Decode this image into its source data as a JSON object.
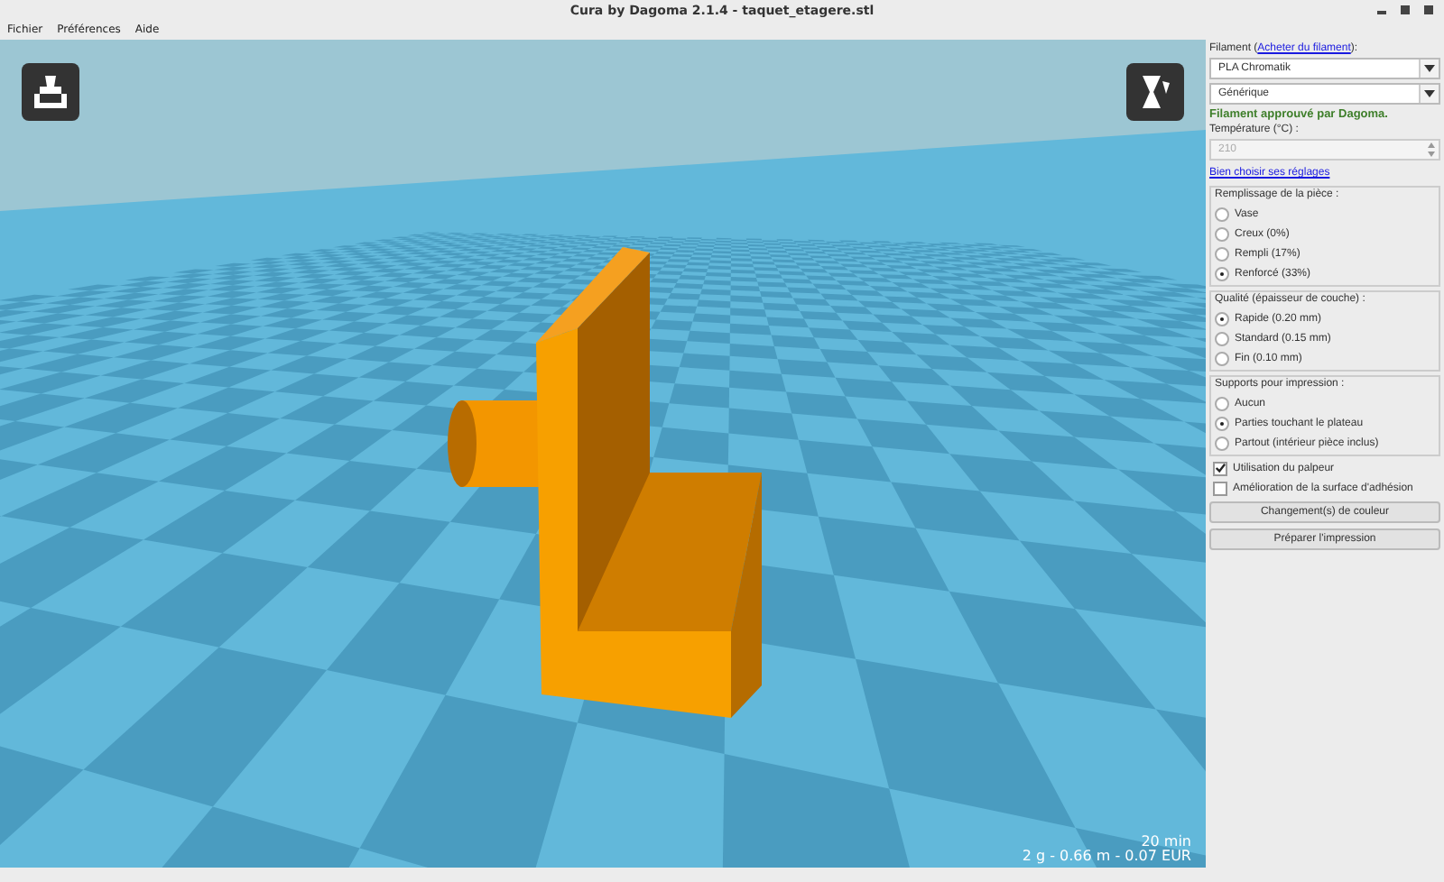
{
  "window": {
    "title": "Cura by Dagoma 2.1.4 - taquet_etagere.stl"
  },
  "menu": [
    "Fichier",
    "Préférences",
    "Aide"
  ],
  "viewport": {
    "print_time": "20 min",
    "print_stats": "2 g - 0.66 m - 0.07 EUR"
  },
  "panel": {
    "filament_label": {
      "prefix": "Filament (",
      "link": "Acheter du filament",
      "suffix": "):"
    },
    "selects": [
      "PLA Chromatik",
      "Générique"
    ],
    "approval": "Filament approuvé par Dagoma.",
    "temperature": {
      "label": "Température (°C) :",
      "value": "210",
      "disabled": true
    },
    "help_link": "Bien choisir ses réglages",
    "groups": [
      {
        "title": "Remplissage de la pièce :",
        "options": [
          {
            "label": "Vase",
            "selected": false
          },
          {
            "label": "Creux (0%)",
            "selected": false
          },
          {
            "label": "Rempli (17%)",
            "selected": false
          },
          {
            "label": "Renforcé (33%)",
            "selected": true
          }
        ]
      },
      {
        "title": "Qualité (épaisseur de couche) :",
        "options": [
          {
            "label": "Rapide (0.20 mm)",
            "selected": true
          },
          {
            "label": "Standard (0.15 mm)",
            "selected": false
          },
          {
            "label": "Fin (0.10 mm)",
            "selected": false
          }
        ]
      },
      {
        "title": "Supports pour impression :",
        "options": [
          {
            "label": "Aucun",
            "selected": false
          },
          {
            "label": "Parties touchant le plateau",
            "selected": true
          },
          {
            "label": "Partout (intérieur pièce inclus)",
            "selected": false
          }
        ]
      }
    ],
    "checkboxes": [
      {
        "label": "Utilisation du palpeur",
        "checked": true
      },
      {
        "label": "Amélioration de la surface d'adhésion",
        "checked": false
      }
    ],
    "buttons": [
      "Changement(s) de couleur",
      "Préparer l'impression"
    ]
  }
}
